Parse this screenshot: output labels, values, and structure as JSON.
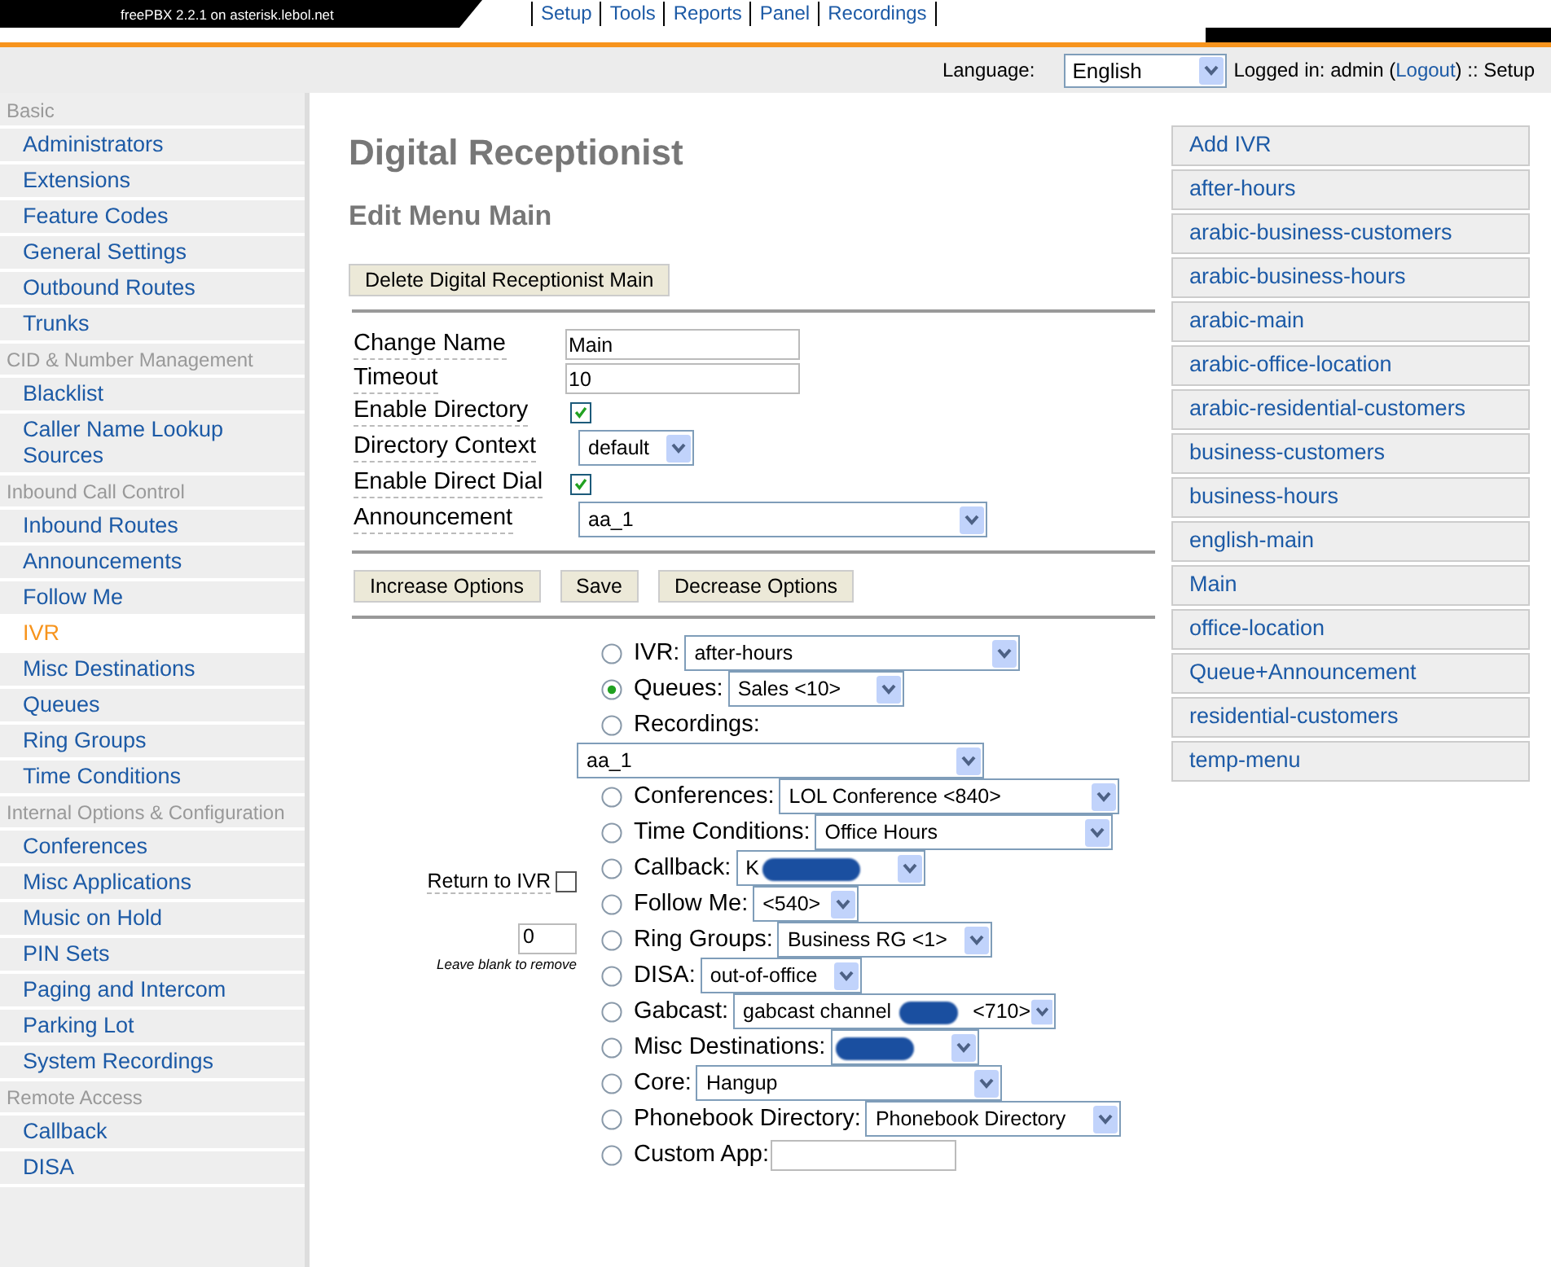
{
  "header": {
    "brand": "freePBX 2.2.1 on asterisk.lebol.net",
    "nav": [
      {
        "label": "Setup"
      },
      {
        "label": "Tools"
      },
      {
        "label": "Reports"
      },
      {
        "label": "Panel"
      },
      {
        "label": "Recordings"
      }
    ]
  },
  "topbar": {
    "language_label": "Language:",
    "language": "English",
    "logged_in": "Logged in: admin (",
    "logout": "Logout",
    "suffix": ") :: Setup"
  },
  "sidebar": [
    {
      "kind": "heading",
      "label": "Basic"
    },
    {
      "kind": "item",
      "label": "Administrators",
      "selected": false
    },
    {
      "kind": "item",
      "label": "Extensions",
      "selected": false
    },
    {
      "kind": "item",
      "label": "Feature Codes",
      "selected": false
    },
    {
      "kind": "item",
      "label": "General Settings",
      "selected": false
    },
    {
      "kind": "item",
      "label": "Outbound Routes",
      "selected": false
    },
    {
      "kind": "item",
      "label": "Trunks",
      "selected": false
    },
    {
      "kind": "heading",
      "label": "CID & Number Management"
    },
    {
      "kind": "item",
      "label": "Blacklist",
      "selected": false
    },
    {
      "kind": "item",
      "label": "Caller Name Lookup Sources",
      "selected": false
    },
    {
      "kind": "heading",
      "label": "Inbound Call Control"
    },
    {
      "kind": "item",
      "label": "Inbound Routes",
      "selected": false
    },
    {
      "kind": "item",
      "label": "Announcements",
      "selected": false
    },
    {
      "kind": "item",
      "label": "Follow Me",
      "selected": false
    },
    {
      "kind": "item",
      "label": "IVR",
      "selected": true
    },
    {
      "kind": "item",
      "label": "Misc Destinations",
      "selected": false
    },
    {
      "kind": "item",
      "label": "Queues",
      "selected": false
    },
    {
      "kind": "item",
      "label": "Ring Groups",
      "selected": false
    },
    {
      "kind": "item",
      "label": "Time Conditions",
      "selected": false
    },
    {
      "kind": "heading",
      "label": "Internal Options & Configuration"
    },
    {
      "kind": "item",
      "label": "Conferences",
      "selected": false
    },
    {
      "kind": "item",
      "label": "Misc Applications",
      "selected": false
    },
    {
      "kind": "item",
      "label": "Music on Hold",
      "selected": false
    },
    {
      "kind": "item",
      "label": "PIN Sets",
      "selected": false
    },
    {
      "kind": "item",
      "label": "Paging and Intercom",
      "selected": false
    },
    {
      "kind": "item",
      "label": "Parking Lot",
      "selected": false
    },
    {
      "kind": "item",
      "label": "System Recordings",
      "selected": false
    },
    {
      "kind": "heading",
      "label": "Remote Access"
    },
    {
      "kind": "item",
      "label": "Callback",
      "selected": false
    },
    {
      "kind": "item",
      "label": "DISA",
      "selected": false
    }
  ],
  "title": "Digital Receptionist",
  "subtitle": "Edit Menu Main",
  "delete_button": "Delete Digital Receptionist Main",
  "form": [
    {
      "kind": "text",
      "label": "Change Name",
      "value": "Main"
    },
    {
      "kind": "text",
      "label": "Timeout",
      "value": "10"
    },
    {
      "kind": "checkbox",
      "label": "Enable Directory",
      "checked": true
    },
    {
      "kind": "select",
      "label": "Directory Context",
      "value": "default"
    },
    {
      "kind": "checkbox",
      "label": "Enable Direct Dial",
      "checked": true
    },
    {
      "kind": "select",
      "label": "Announcement",
      "value": "aa_1"
    }
  ],
  "actions": [
    "Increase Options",
    "Save",
    "Decrease Options"
  ],
  "return_block": {
    "label": "Return to IVR",
    "checked": false,
    "digit": "0",
    "hint": "Leave blank to remove"
  },
  "destinations": [
    {
      "kind": "select",
      "label": "IVR:",
      "value": "after-hours",
      "selected": false
    },
    {
      "kind": "select",
      "label": "Queues:",
      "value": "Sales <10>",
      "selected": true
    },
    {
      "kind": "select-below",
      "label": "Recordings:",
      "value": "aa_1",
      "selected": false
    },
    {
      "kind": "select",
      "label": "Conferences:",
      "value": "LOL Conference <840>",
      "selected": false
    },
    {
      "kind": "select",
      "label": "Time Conditions:",
      "value": "Office Hours",
      "selected": false
    },
    {
      "kind": "select",
      "label": "Callback:",
      "value": "K",
      "redacted": true,
      "selected": false
    },
    {
      "kind": "select",
      "label": "Follow Me:",
      "value": "<540>",
      "selected": false
    },
    {
      "kind": "select",
      "label": "Ring Groups:",
      "value": "Business RG <1>",
      "selected": false
    },
    {
      "kind": "select",
      "label": "DISA:",
      "value": "out-of-office",
      "selected": false
    },
    {
      "kind": "select",
      "label": "Gabcast:",
      "value": "gabcast channel",
      "value_after": "<710>",
      "redacted": true,
      "selected": false
    },
    {
      "kind": "select",
      "label": "Misc Destinations:",
      "redacted": true,
      "selected": false
    },
    {
      "kind": "select",
      "label": "Core:",
      "value": "Hangup",
      "selected": false
    },
    {
      "kind": "select",
      "label": "Phonebook Directory:",
      "value": "Phonebook Directory",
      "selected": false
    },
    {
      "kind": "input",
      "label": "Custom App:",
      "selected": false
    }
  ],
  "ivr_list": [
    "Add IVR",
    "after-hours",
    "arabic-business-customers",
    "arabic-business-hours",
    "arabic-main",
    "arabic-office-location",
    "arabic-residential-customers",
    "business-customers",
    "business-hours",
    "english-main",
    "Main",
    "office-location",
    "Queue+Announcement",
    "residential-customers",
    "temp-menu"
  ]
}
